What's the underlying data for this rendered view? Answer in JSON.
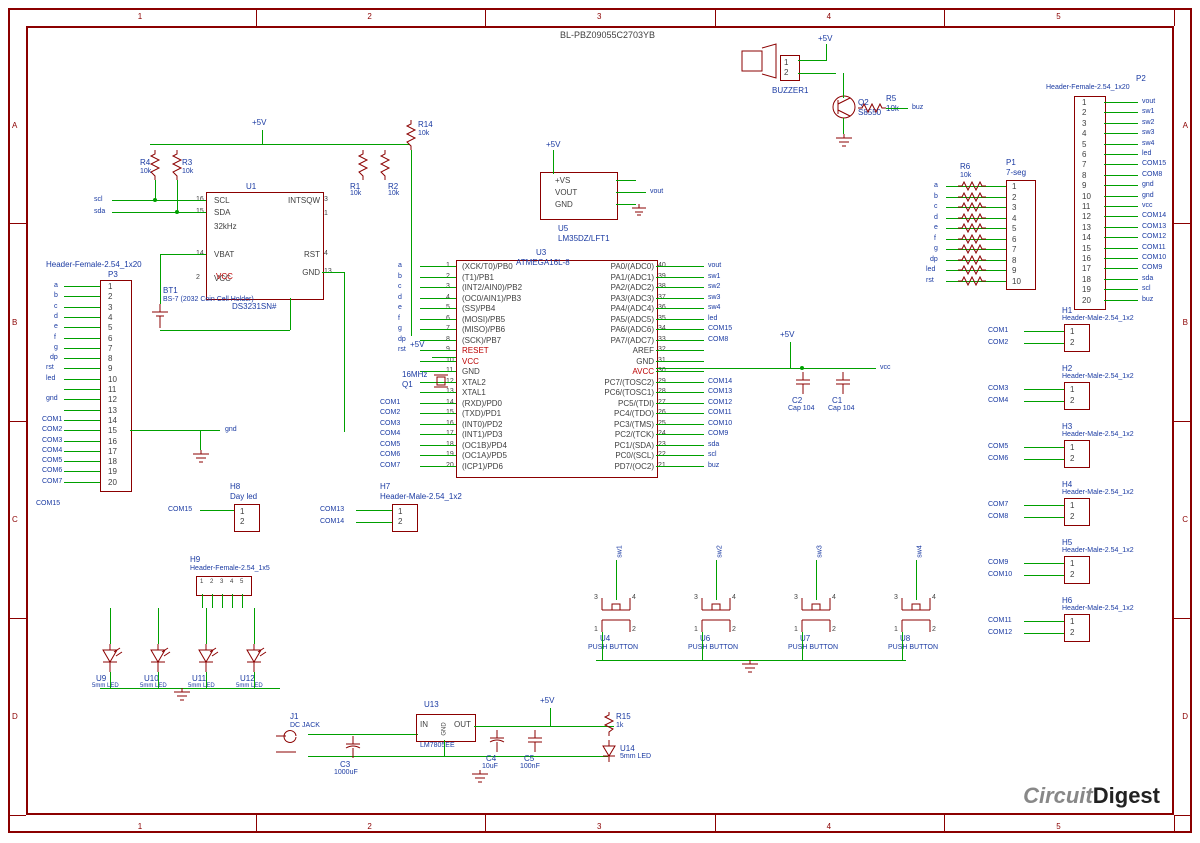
{
  "title": "BL-PBZ09055C2703YB",
  "logo": "CircuitDigest",
  "border": {
    "cols": [
      "1",
      "2",
      "3",
      "4",
      "5"
    ],
    "rows": [
      "A",
      "B",
      "C",
      "D"
    ]
  },
  "power": {
    "p5v": "+5V"
  },
  "components": {
    "U1": {
      "ref": "U1",
      "part": "DS3231SN#",
      "pins_left": [
        {
          "n": "16",
          "name": "SCL"
        },
        {
          "n": "15",
          "name": "SDA"
        },
        {
          "n": "",
          "name": "32kHz"
        },
        {
          "n": "14",
          "name": "VBAT"
        },
        {
          "n": "",
          "name": ""
        },
        {
          "n": "2",
          "name": "VCC"
        }
      ],
      "pins_right": [
        {
          "n": "3",
          "name": "INTSQW"
        },
        {
          "n": "1",
          "name": ""
        },
        {
          "n": "4",
          "name": "RST"
        },
        {
          "n": "13",
          "name": "GND"
        }
      ]
    },
    "U3": {
      "ref": "U3",
      "part": "ATMEGA16L-8",
      "left": [
        {
          "n": "1",
          "name": "(XCK/T0)/PB0"
        },
        {
          "n": "2",
          "name": "(T1)/PB1"
        },
        {
          "n": "3",
          "name": "(INT2/AIN0)/PB2"
        },
        {
          "n": "4",
          "name": "(OC0/AIN1)/PB3"
        },
        {
          "n": "5",
          "name": "(SS)/PB4"
        },
        {
          "n": "6",
          "name": "(MOSI)/PB5"
        },
        {
          "n": "7",
          "name": "(MISO)/PB6"
        },
        {
          "n": "8",
          "name": "(SCK)/PB7"
        },
        {
          "n": "9",
          "name": "RESET"
        },
        {
          "n": "10",
          "name": "VCC"
        },
        {
          "n": "11",
          "name": "GND"
        },
        {
          "n": "12",
          "name": "XTAL2"
        },
        {
          "n": "13",
          "name": "XTAL1"
        },
        {
          "n": "14",
          "name": "(RXD)/PD0"
        },
        {
          "n": "15",
          "name": "(TXD)/PD1"
        },
        {
          "n": "16",
          "name": "(INT0)/PD2"
        },
        {
          "n": "17",
          "name": "(INT1)/PD3"
        },
        {
          "n": "18",
          "name": "(OC1B)/PD4"
        },
        {
          "n": "19",
          "name": "(OC1A)/PD5"
        },
        {
          "n": "20",
          "name": "(ICP1)/PD6"
        }
      ],
      "right": [
        {
          "n": "40",
          "name": "PA0/(ADC0)"
        },
        {
          "n": "39",
          "name": "PA1/(ADC1)"
        },
        {
          "n": "38",
          "name": "PA2/(ADC2)"
        },
        {
          "n": "37",
          "name": "PA3/(ADC3)"
        },
        {
          "n": "36",
          "name": "PA4/(ADC4)"
        },
        {
          "n": "35",
          "name": "PA5/(ADC5)"
        },
        {
          "n": "34",
          "name": "PA6/(ADC6)"
        },
        {
          "n": "33",
          "name": "PA7/(ADC7)"
        },
        {
          "n": "32",
          "name": "AREF"
        },
        {
          "n": "31",
          "name": "GND"
        },
        {
          "n": "30",
          "name": "AVCC"
        },
        {
          "n": "29",
          "name": "PC7/(TOSC2)"
        },
        {
          "n": "28",
          "name": "PC6/(TOSC1)"
        },
        {
          "n": "27",
          "name": "PC5/(TDI)"
        },
        {
          "n": "26",
          "name": "PC4/(TDO)"
        },
        {
          "n": "25",
          "name": "PC3/(TMS)"
        },
        {
          "n": "24",
          "name": "PC2/(TCK)"
        },
        {
          "n": "23",
          "name": "PC1/(SDA)"
        },
        {
          "n": "22",
          "name": "PC0/(SCL)"
        },
        {
          "n": "21",
          "name": "PD7/(OC2)"
        }
      ]
    },
    "U5": {
      "ref": "U5",
      "part": "LM35DZ/LFT1",
      "pins": [
        "+VS",
        "VOUT",
        "GND"
      ]
    },
    "U13": {
      "ref": "U13",
      "part": "LM7805EE",
      "pins": [
        "IN",
        "GND",
        "OUT"
      ]
    },
    "BT1": {
      "ref": "BT1",
      "part": "BS-7 (2032 Coin Cell Holder)"
    },
    "Q1": {
      "ref": "Q1",
      "part": "16MHz"
    },
    "Q2": {
      "ref": "Q2",
      "part": "S8550"
    },
    "BUZZER1": {
      "ref": "BUZZER1",
      "pins": [
        "1",
        "2"
      ]
    },
    "J1": {
      "ref": "J1",
      "part": "DC JACK"
    },
    "R1": {
      "ref": "R1",
      "val": "10k"
    },
    "R2": {
      "ref": "R2",
      "val": "10k"
    },
    "R3": {
      "ref": "R3",
      "val": "10k"
    },
    "R4": {
      "ref": "R4",
      "val": "10k"
    },
    "R5": {
      "ref": "R5",
      "val": "10k"
    },
    "R14": {
      "ref": "R14",
      "val": "10k"
    },
    "R15": {
      "ref": "R15",
      "val": "1k"
    },
    "R6": {
      "ref": "R6",
      "val": "10k"
    },
    "C1": {
      "ref": "C1",
      "val": "Cap 104"
    },
    "C2": {
      "ref": "C2",
      "val": "Cap 104"
    },
    "C3": {
      "ref": "C3",
      "val": "1000uF"
    },
    "C4": {
      "ref": "C4",
      "val": "10uF"
    },
    "C5": {
      "ref": "C5",
      "val": "100nF"
    },
    "U9": {
      "ref": "U9",
      "val": "5mm LED"
    },
    "U10": {
      "ref": "U10",
      "val": "5mm LED"
    },
    "U11": {
      "ref": "U11",
      "val": "5mm LED"
    },
    "U12": {
      "ref": "U12",
      "val": "5mm LED"
    },
    "U14": {
      "ref": "U14",
      "val": "5mm LED"
    },
    "U4": {
      "ref": "U4",
      "val": "PUSH BUTTON"
    },
    "U6": {
      "ref": "U6",
      "val": "PUSH BUTTON"
    },
    "U7": {
      "ref": "U7",
      "val": "PUSH BUTTON"
    },
    "U8": {
      "ref": "U8",
      "val": "PUSH BUTTON"
    }
  },
  "headers": {
    "P1": {
      "ref": "P1",
      "part": "7-seg",
      "pins": 10,
      "nets": [
        "a",
        "b",
        "c",
        "d",
        "e",
        "f",
        "g",
        "dp",
        "led",
        "rst"
      ]
    },
    "P2": {
      "ref": "P2",
      "part": "Header-Female-2.54_1x20",
      "pins": 20,
      "nets": [
        "vout",
        "sw1",
        "sw2",
        "sw3",
        "sw4",
        "led",
        "COM15",
        "COM8",
        "gnd",
        "gnd",
        "vcc",
        "COM14",
        "COM13",
        "COM12",
        "COM11",
        "COM10",
        "COM9",
        "sda",
        "scl",
        "buz"
      ]
    },
    "P3": {
      "ref": "P3",
      "part": "Header-Female-2.54_1x20",
      "pins": 20,
      "nets": [
        "a",
        "b",
        "c",
        "d",
        "e",
        "f",
        "g",
        "dp",
        "rst",
        "led",
        "",
        "gnd",
        "",
        "COM1",
        "COM2",
        "COM3",
        "COM4",
        "COM5",
        "COM6",
        "COM7"
      ]
    },
    "H1": {
      "ref": "H1",
      "part": "Header-Male-2.54_1x2",
      "nets": [
        "COM1",
        "COM2"
      ]
    },
    "H2": {
      "ref": "H2",
      "part": "Header-Male-2.54_1x2",
      "nets": [
        "COM3",
        "COM4"
      ]
    },
    "H3": {
      "ref": "H3",
      "part": "Header-Male-2.54_1x2",
      "nets": [
        "COM5",
        "COM6"
      ]
    },
    "H4": {
      "ref": "H4",
      "part": "Header-Male-2.54_1x2",
      "nets": [
        "COM7",
        "COM8"
      ]
    },
    "H5": {
      "ref": "H5",
      "part": "Header-Male-2.54_1x2",
      "nets": [
        "COM9",
        "COM10"
      ]
    },
    "H6": {
      "ref": "H6",
      "part": "Header-Male-2.54_1x2",
      "nets": [
        "COM11",
        "COM12"
      ]
    },
    "H7": {
      "ref": "H7",
      "part": "Header-Male-2.54_1x2",
      "nets": [
        "COM13",
        "COM14"
      ]
    },
    "H8": {
      "ref": "H8",
      "part": "Day led",
      "nets": [
        "COM15",
        ""
      ]
    },
    "H9": {
      "ref": "H9",
      "part": "Header-Female-2.54_1x5",
      "pins": 5
    }
  },
  "netlabels": {
    "u3_left": [
      "a",
      "b",
      "c",
      "d",
      "e",
      "f",
      "g",
      "dp",
      "rst",
      "",
      "",
      "",
      "",
      "COM1",
      "COM2",
      "COM3",
      "COM4",
      "COM5",
      "COM6",
      "COM7"
    ],
    "u3_right": [
      "vout",
      "sw1",
      "sw2",
      "sw3",
      "sw4",
      "led",
      "COM15",
      "COM8",
      "",
      "",
      "",
      "COM14",
      "COM13",
      "COM12",
      "COM11",
      "COM10",
      "COM9",
      "sda",
      "scl",
      "buz"
    ],
    "buttons": [
      "sw1",
      "sw2",
      "sw3",
      "sw4"
    ],
    "misc": {
      "scl": "scl",
      "sda": "sda",
      "vcc": "vcc",
      "gnd": "gnd",
      "buz": "buz",
      "vout": "vout",
      "led": "led"
    }
  }
}
